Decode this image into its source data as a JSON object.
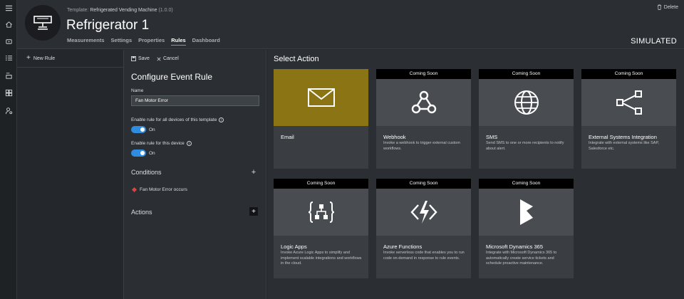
{
  "header": {
    "template_prefix": "Template:",
    "template_name": "Refrigerated Vending Machine",
    "template_version": "(1.0.0)",
    "device_name": "Refrigerator 1",
    "tabs": [
      {
        "label": "Measurements"
      },
      {
        "label": "Settings"
      },
      {
        "label": "Properties"
      },
      {
        "label": "Rules"
      },
      {
        "label": "Dashboard"
      }
    ],
    "active_tab": "Rules",
    "delete_label": "Delete",
    "status": "SIMULATED"
  },
  "rail": {
    "icons": [
      "menu-icon",
      "home-icon",
      "device-icon",
      "list-icon",
      "template-icon",
      "grid-icon",
      "user-settings-icon"
    ]
  },
  "rules_pane": {
    "new_rule_label": "New Rule"
  },
  "config": {
    "save_label": "Save",
    "cancel_label": "Cancel",
    "title": "Configure Event Rule",
    "name_label": "Name",
    "name_value": "Fan Motor Error",
    "enable_all_label": "Enable rule for all devices of this template",
    "enable_all_state": "On",
    "enable_device_label": "Enable rule for this device",
    "enable_device_state": "On",
    "conditions_title": "Conditions",
    "condition_item": "Fan Motor Error occurs",
    "actions_title": "Actions"
  },
  "actions": {
    "title": "Select Action",
    "cards": [
      {
        "title": "Email",
        "banner": "",
        "desc": "",
        "icon": "envelope-icon"
      },
      {
        "title": "Webhook",
        "banner": "Coming Soon",
        "desc": "Invoke a webhook to trigger external custom workflows.",
        "icon": "webhook-icon"
      },
      {
        "title": "SMS",
        "banner": "Coming Soon",
        "desc": "Send SMS to one or more recipients to notify about alert.",
        "icon": "globe-icon"
      },
      {
        "title": "External Systems Integration",
        "banner": "Coming Soon",
        "desc": "Integrate with external systems like SAP, Salesforce etc.",
        "icon": "share-icon"
      },
      {
        "title": "Logic Apps",
        "banner": "Coming Soon",
        "desc": "Invoke Azure Logic Apps to simplify and implement scalable integrations and workflows in the cloud.",
        "icon": "logic-apps-icon"
      },
      {
        "title": "Azure Functions",
        "banner": "Coming Soon",
        "desc": "Invoke serverless code that enables you to run code on-demand in response to rule events.",
        "icon": "azure-functions-icon"
      },
      {
        "title": "Microsoft Dynamics 365",
        "banner": "Coming Soon",
        "desc": "Integrate with Microsoft Dynamics 365 to automatically create service tickets and schedule proactive maintenance.",
        "icon": "dynamics-icon"
      }
    ]
  },
  "colors": {
    "accent": "#2f8cde",
    "email_tile": "#8b7413",
    "condition_marker": "#e0413b"
  }
}
